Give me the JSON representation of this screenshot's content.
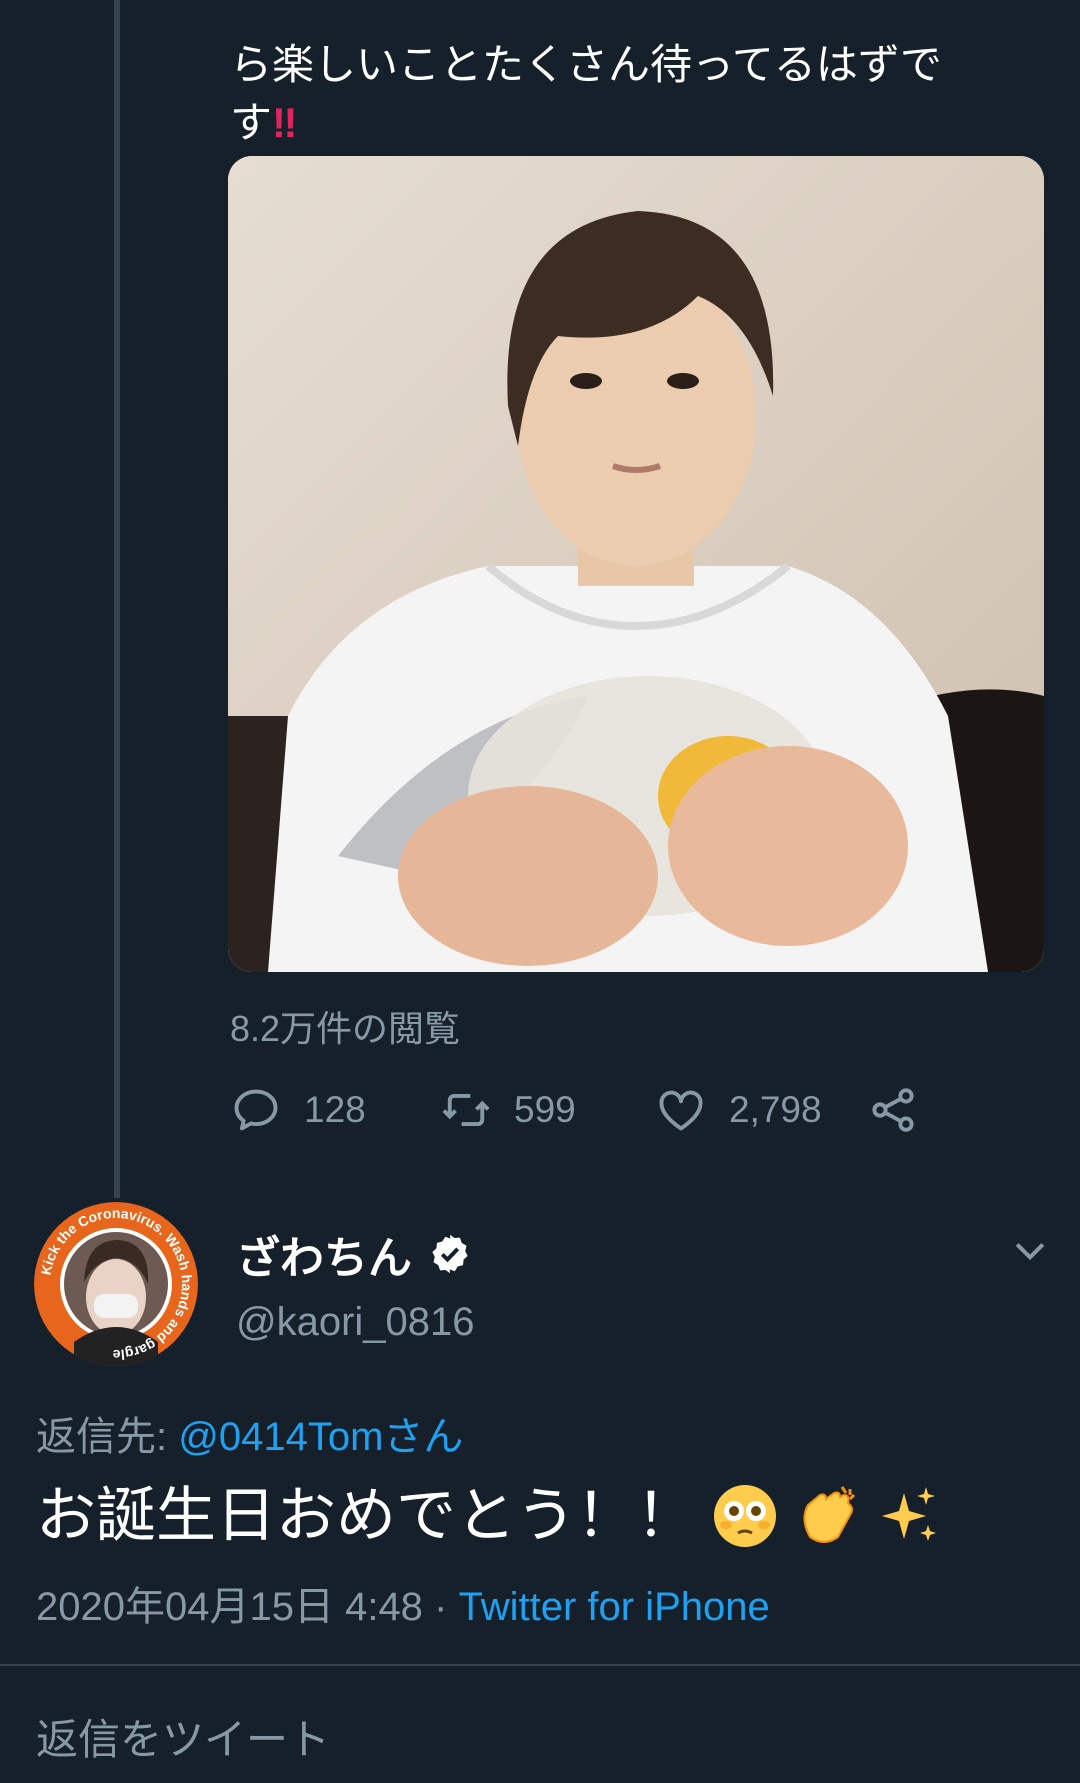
{
  "tweet_continuation": {
    "line1": "ら楽しいことたくさん待ってるはずで",
    "line2": "す",
    "emphasis": "‼"
  },
  "media": {
    "alt": "video-thumbnail"
  },
  "views": "8.2万件の閲覧",
  "actions": {
    "reply_count": "128",
    "retweet_count": "599",
    "like_count": "2,798"
  },
  "reply": {
    "user_name": "ざわちん",
    "handle": "@kaori_0816",
    "avatar_ring_text": "Kick the Coronavirus. Wash hands and gargle",
    "reply_to_label": "返信先: ",
    "reply_to_mention": "@0414Tomさん",
    "text": "お誕生日おめでとう！！",
    "emojis": [
      "flushed-face",
      "clapping-hands",
      "sparkles"
    ],
    "timestamp": "2020年04月15日 4:48 · ",
    "source": "Twitter for iPhone"
  },
  "reply_input": {
    "placeholder": "返信をツイート"
  },
  "colors": {
    "background": "#15202b",
    "secondary_text": "#8899a6",
    "link": "#1da1f2",
    "emphasis": "#e0245e",
    "divider": "#38444d"
  }
}
